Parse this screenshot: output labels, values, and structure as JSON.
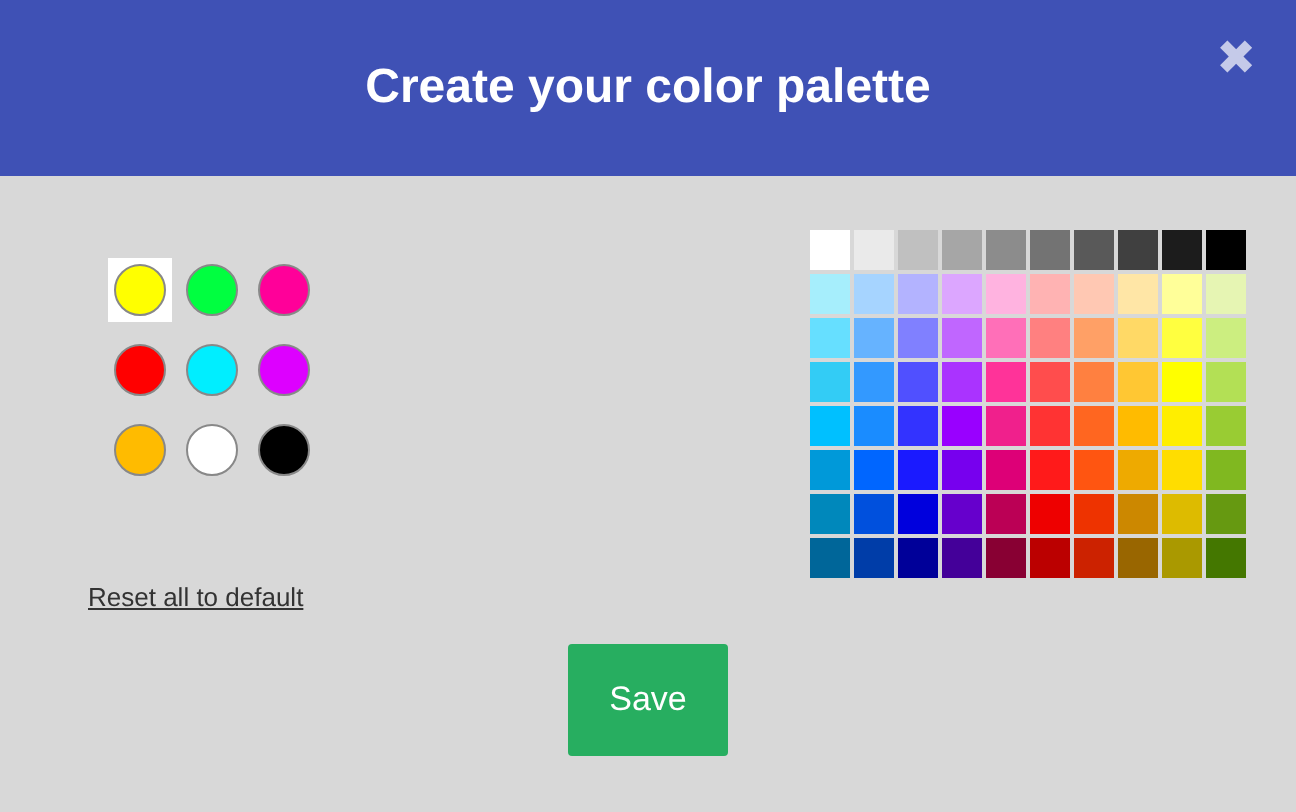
{
  "dialog": {
    "title": "Create your color palette",
    "close": "✖"
  },
  "palette": [
    {
      "color": "#ffff00",
      "selected": true
    },
    {
      "color": "#00ff40",
      "selected": false
    },
    {
      "color": "#ff0099",
      "selected": false
    },
    {
      "color": "#ff0000",
      "selected": false
    },
    {
      "color": "#00eeff",
      "selected": false
    },
    {
      "color": "#dd00ff",
      "selected": false
    },
    {
      "color": "#ffbb00",
      "selected": false
    },
    {
      "color": "#ffffff",
      "selected": false
    },
    {
      "color": "#000000",
      "selected": false
    }
  ],
  "reset_link": "Reset all to default",
  "color_grid": [
    {
      "swatches": [
        {
          "color": "#ffffff"
        },
        {
          "color": "#eaeaea"
        },
        {
          "color": "#c0c0c0"
        },
        {
          "color": "#a6a6a6"
        },
        {
          "color": "#8c8c8c"
        },
        {
          "color": "#737373"
        },
        {
          "color": "#595959"
        },
        {
          "color": "#404040"
        },
        {
          "color": "#1c1c1c"
        },
        {
          "color": "#000000"
        }
      ]
    },
    {
      "swatches": [
        {
          "color": "#a6eefc"
        },
        {
          "color": "#a6d4ff"
        },
        {
          "color": "#b3b3ff"
        },
        {
          "color": "#dca6ff"
        },
        {
          "color": "#ffb3e0"
        },
        {
          "color": "#ffb3b3"
        },
        {
          "color": "#ffc8b3"
        },
        {
          "color": "#ffe6a6"
        },
        {
          "color": "#ffff99"
        },
        {
          "color": "#e6f5b3"
        }
      ]
    },
    {
      "swatches": [
        {
          "color": "#66dfff"
        },
        {
          "color": "#66b3ff"
        },
        {
          "color": "#8080ff"
        },
        {
          "color": "#c066ff"
        },
        {
          "color": "#ff6fb8"
        },
        {
          "color": "#ff8080"
        },
        {
          "color": "#ffa066"
        },
        {
          "color": "#ffd966"
        },
        {
          "color": "#ffff40"
        },
        {
          "color": "#ccee80"
        }
      ]
    },
    {
      "swatches": [
        {
          "color": "#33ccf5"
        },
        {
          "color": "#3399ff"
        },
        {
          "color": "#5050ff"
        },
        {
          "color": "#aa33ff"
        },
        {
          "color": "#ff3399"
        },
        {
          "color": "#ff4d4d"
        },
        {
          "color": "#ff8040"
        },
        {
          "color": "#ffc733"
        },
        {
          "color": "#ffff00"
        },
        {
          "color": "#b3e055"
        }
      ]
    },
    {
      "swatches": [
        {
          "color": "#00c0ff"
        },
        {
          "color": "#1a8cff"
        },
        {
          "color": "#3333ff"
        },
        {
          "color": "#9900ff"
        },
        {
          "color": "#f0208c"
        },
        {
          "color": "#ff3333"
        },
        {
          "color": "#ff6620"
        },
        {
          "color": "#ffbb00"
        },
        {
          "color": "#ffee00"
        },
        {
          "color": "#99cc33"
        }
      ]
    },
    {
      "swatches": [
        {
          "color": "#0099d9"
        },
        {
          "color": "#0066ff"
        },
        {
          "color": "#1a1aff"
        },
        {
          "color": "#7700ee"
        },
        {
          "color": "#dd0077"
        },
        {
          "color": "#ff1a1a"
        },
        {
          "color": "#ff5511"
        },
        {
          "color": "#eeaa00"
        },
        {
          "color": "#ffdd00"
        },
        {
          "color": "#80b820"
        }
      ]
    },
    {
      "swatches": [
        {
          "color": "#0088bb"
        },
        {
          "color": "#0050dd"
        },
        {
          "color": "#0000dd"
        },
        {
          "color": "#6600cc"
        },
        {
          "color": "#bb0055"
        },
        {
          "color": "#ee0000"
        },
        {
          "color": "#ee3300"
        },
        {
          "color": "#cc8800"
        },
        {
          "color": "#ddbb00"
        },
        {
          "color": "#669911"
        }
      ]
    },
    {
      "swatches": [
        {
          "color": "#006699"
        },
        {
          "color": "#003da8"
        },
        {
          "color": "#000099"
        },
        {
          "color": "#440099"
        },
        {
          "color": "#880033"
        },
        {
          "color": "#bb0000"
        },
        {
          "color": "#cc2200"
        },
        {
          "color": "#996600"
        },
        {
          "color": "#aa9900"
        },
        {
          "color": "#447700"
        }
      ]
    }
  ],
  "save_button": "Save"
}
